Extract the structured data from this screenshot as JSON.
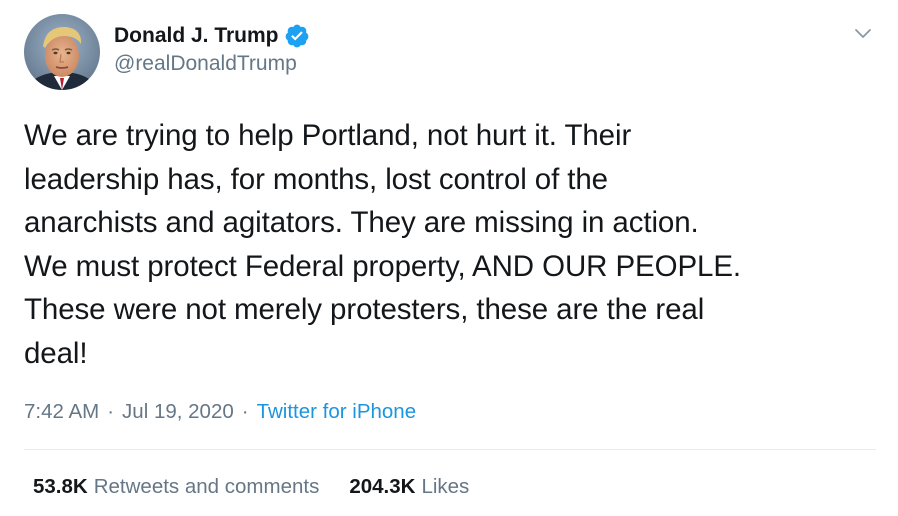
{
  "author": {
    "display_name": "Donald J. Trump",
    "handle": "@realDonaldTrump",
    "verified": true,
    "avatar_icon": "profile-photo"
  },
  "tweet": {
    "text": "We are trying to help Portland, not hurt it. Their\nleadership has, for months, lost control of the\nanarchists and agitators. They are missing in action.\nWe must protect Federal property, AND OUR PEOPLE.\nThese were not merely protesters, these are the real\ndeal!"
  },
  "meta": {
    "time": "7:42 AM",
    "separator": "·",
    "date": "Jul 19, 2020",
    "source": "Twitter for iPhone"
  },
  "stats": {
    "retweets_count": "53.8K",
    "retweets_label": "Retweets and comments",
    "likes_count": "204.3K",
    "likes_label": "Likes"
  },
  "colors": {
    "text": "#14171a",
    "secondary": "#657786",
    "accent": "#1b95e0",
    "verified_badge": "#1da1f2",
    "divider": "#e6ecf0"
  },
  "icons": {
    "verified": "verified-badge-icon",
    "menu": "chevron-down-icon"
  }
}
